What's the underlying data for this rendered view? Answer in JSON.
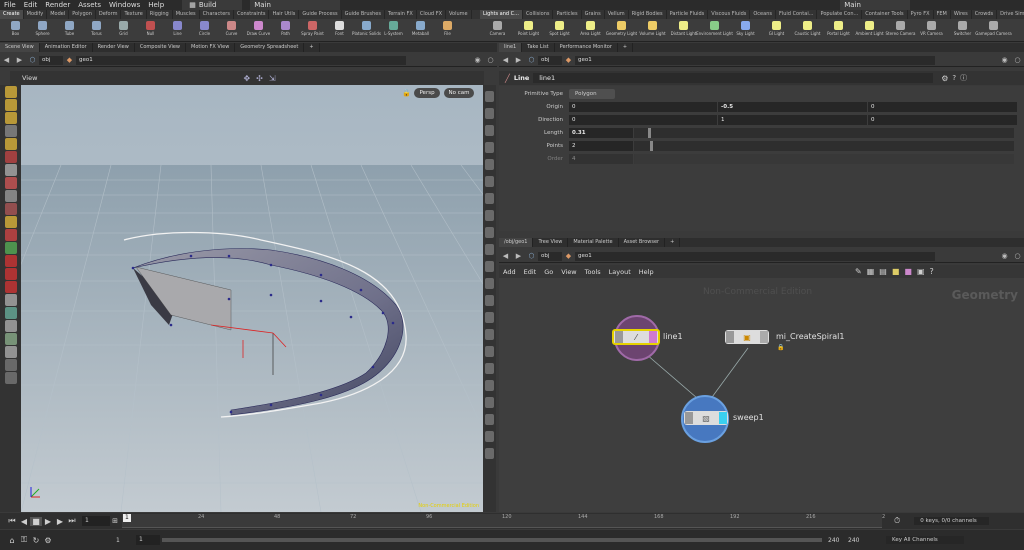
{
  "menu": [
    "File",
    "Edit",
    "Render",
    "Assets",
    "Windows",
    "Help"
  ],
  "desktop": "Build",
  "main_desktop_left": "Main",
  "main_desktop_right": "Main",
  "shelf_tabs_left": [
    "Create",
    "Modify",
    "Model",
    "Polygon",
    "Deform",
    "Texture",
    "Rigging",
    "Muscles",
    "Characters",
    "Constraints",
    "Hair Utils",
    "Guide Process",
    "Guide Brushes",
    "Terrain FX",
    "Cloud FX",
    "Volume"
  ],
  "shelf_tabs_right": [
    "Lights and C...",
    "Collisions",
    "Particles",
    "Grains",
    "Vellum",
    "Rigid Bodies",
    "Particle Fluids",
    "Viscous Fluids",
    "Oceans",
    "Fluid Contai...",
    "Populate Con...",
    "Container Tools",
    "Pyro FX",
    "FEM",
    "Wires",
    "Crowds",
    "Drive Simula..."
  ],
  "tools_left": [
    {
      "label": "Box",
      "color": "#8fa7c4"
    },
    {
      "label": "Sphere",
      "color": "#8fa7c4"
    },
    {
      "label": "Tube",
      "color": "#8fa7c4"
    },
    {
      "label": "Torus",
      "color": "#8fa7c4"
    },
    {
      "label": "Grid",
      "color": "#9aa"
    },
    {
      "label": "Null",
      "color": "#c05050"
    },
    {
      "label": "Line",
      "color": "#88c"
    },
    {
      "label": "Circle",
      "color": "#88c"
    },
    {
      "label": "Curve",
      "color": "#c88"
    },
    {
      "label": "Draw Curve",
      "color": "#c8c"
    },
    {
      "label": "Path",
      "color": "#a8c"
    },
    {
      "label": "Spray Paint",
      "color": "#c66"
    },
    {
      "label": "Font",
      "color": "#ddd"
    },
    {
      "label": "Platonic Solids",
      "color": "#8ac"
    },
    {
      "label": "L-System",
      "color": "#6a9"
    },
    {
      "label": "Metaball",
      "color": "#8ac"
    },
    {
      "label": "File",
      "color": "#da6"
    }
  ],
  "tools_right": [
    {
      "label": "Camera",
      "color": "#aaa"
    },
    {
      "label": "Point Light",
      "color": "#ee8"
    },
    {
      "label": "Spot Light",
      "color": "#ee8"
    },
    {
      "label": "Area Light",
      "color": "#ee8"
    },
    {
      "label": "Geometry Light",
      "color": "#ec6"
    },
    {
      "label": "Volume Light",
      "color": "#ec6"
    },
    {
      "label": "Distant Light",
      "color": "#ee8"
    },
    {
      "label": "Environment Light",
      "color": "#8c8"
    },
    {
      "label": "Sky Light",
      "color": "#8ae"
    },
    {
      "label": "GI Light",
      "color": "#ee8"
    },
    {
      "label": "Caustic Light",
      "color": "#ee8"
    },
    {
      "label": "Portal Light",
      "color": "#ee8"
    },
    {
      "label": "Ambient Light",
      "color": "#ee8"
    },
    {
      "label": "Stereo Camera",
      "color": "#aaa"
    },
    {
      "label": "VR Camera",
      "color": "#aaa"
    },
    {
      "label": "Switcher",
      "color": "#aaa"
    },
    {
      "label": "Gamepad Camera",
      "color": "#aaa"
    }
  ],
  "left_pane_tabs": [
    "Scene View",
    "Animation Editor",
    "Render View",
    "Composite View",
    "Motion FX View",
    "Geometry Spreadsheet"
  ],
  "right_top_tabs": [
    "line1",
    "Take List",
    "Performance Monitor"
  ],
  "right_bottom_tabs": [
    "/obj/geo1",
    "Tree View",
    "Material Palette",
    "Asset Browser"
  ],
  "path": {
    "level1": "obj",
    "level2": "geo1"
  },
  "viewport": {
    "title": "View",
    "persp": "Persp",
    "cam": "No cam",
    "watermark": "Non-Commercial Edition"
  },
  "parms": {
    "node_type": "Line",
    "node_name": "line1",
    "primitive_type_label": "Primitive Type",
    "primitive_type": "Polygon",
    "origin_label": "Origin",
    "origin": [
      "0",
      "-0.5",
      "0"
    ],
    "direction_label": "Direction",
    "direction": [
      "0",
      "1",
      "0"
    ],
    "length_label": "Length",
    "length": "0.31",
    "points_label": "Points",
    "points": "2",
    "order_label": "Order",
    "order": "4"
  },
  "network": {
    "menu": [
      "Add",
      "Edit",
      "Go",
      "View",
      "Tools",
      "Layout",
      "Help"
    ],
    "watermark": "Non-Commercial Edition",
    "context": "Geometry",
    "nodes": {
      "line": "line1",
      "spiral": "mi_CreateSpiral1",
      "sweep": "sweep1"
    }
  },
  "timeline": {
    "ticks": [
      "1",
      "24",
      "48",
      "72",
      "96",
      "120",
      "144",
      "168",
      "192",
      "216",
      "2"
    ],
    "current_frame": "1",
    "start": "1",
    "start2": "1",
    "end": "240",
    "end2": "240",
    "keys_label": "0 keys, 0/0 channels",
    "key_channels": "Key All Channels"
  }
}
